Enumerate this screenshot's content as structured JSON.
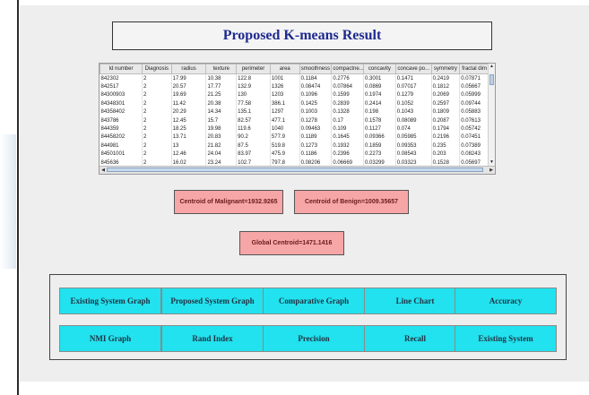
{
  "header": {
    "title": "Proposed K-means Result"
  },
  "table": {
    "columns": [
      "Id number",
      "Diagnosis",
      "radius",
      "texture",
      "perimeter",
      "area",
      "smoothness",
      "compactne...",
      "concavity",
      "concave po...",
      "symmetry",
      "fractal dim"
    ],
    "rows": [
      [
        "842302",
        "2",
        "17.99",
        "10.38",
        "122.8",
        "1001",
        "0.1184",
        "0.2776",
        "0.3001",
        "0.1471",
        "0.2419",
        "0.07871"
      ],
      [
        "842517",
        "2",
        "20.57",
        "17.77",
        "132.9",
        "1326",
        "0.08474",
        "0.07864",
        "0.0869",
        "0.07017",
        "0.1812",
        "0.05667"
      ],
      [
        "84300903",
        "2",
        "19.69",
        "21.25",
        "130",
        "1203",
        "0.1096",
        "0.1599",
        "0.1974",
        "0.1279",
        "0.2069",
        "0.05999"
      ],
      [
        "84348301",
        "2",
        "11.42",
        "20.38",
        "77.58",
        "386.1",
        "0.1425",
        "0.2839",
        "0.2414",
        "0.1052",
        "0.2597",
        "0.09744"
      ],
      [
        "84358402",
        "2",
        "20.29",
        "14.34",
        "135.1",
        "1297",
        "0.1003",
        "0.1328",
        "0.198",
        "0.1043",
        "0.1809",
        "0.05883"
      ],
      [
        "843786",
        "2",
        "12.45",
        "15.7",
        "82.57",
        "477.1",
        "0.1278",
        "0.17",
        "0.1578",
        "0.08089",
        "0.2087",
        "0.07613"
      ],
      [
        "844359",
        "2",
        "18.25",
        "19.98",
        "119.6",
        "1040",
        "0.09463",
        "0.109",
        "0.1127",
        "0.074",
        "0.1794",
        "0.05742"
      ],
      [
        "84458202",
        "2",
        "13.71",
        "20.83",
        "90.2",
        "577.9",
        "0.1189",
        "0.1645",
        "0.09366",
        "0.05985",
        "0.2196",
        "0.07451"
      ],
      [
        "844981",
        "2",
        "13",
        "21.82",
        "87.5",
        "519.8",
        "0.1273",
        "0.1932",
        "0.1859",
        "0.09353",
        "0.235",
        "0.07389"
      ],
      [
        "84501001",
        "2",
        "12.46",
        "24.04",
        "83.97",
        "475.9",
        "0.1186",
        "0.2396",
        "0.2273",
        "0.08543",
        "0.203",
        "0.08243"
      ],
      [
        "845636",
        "2",
        "16.02",
        "23.24",
        "102.7",
        "797.8",
        "0.08206",
        "0.06669",
        "0.03299",
        "0.03323",
        "0.1528",
        "0.05697"
      ]
    ]
  },
  "centroids": {
    "malignant": "Centroid of Malignant=1932.9265",
    "benign": "Centroid of Benign=1009.35657",
    "global": "Global Centroid=1471.1416"
  },
  "buttons": {
    "existing_graph": "Existing System Graph",
    "proposed_graph": "Proposed System Graph",
    "comparative_graph": "Comparative Graph",
    "line_chart": "Line Chart",
    "accuracy": "Accuracy",
    "nmi_graph": "NMI Graph",
    "rand_index": "Rand Index",
    "precision": "Precision",
    "recall": "Recall",
    "existing_system": "Existing System"
  },
  "colors": {
    "button_bg": "#21e2ee",
    "centroid_bg": "#f6a6a6",
    "title_color": "#1f2a8e"
  }
}
